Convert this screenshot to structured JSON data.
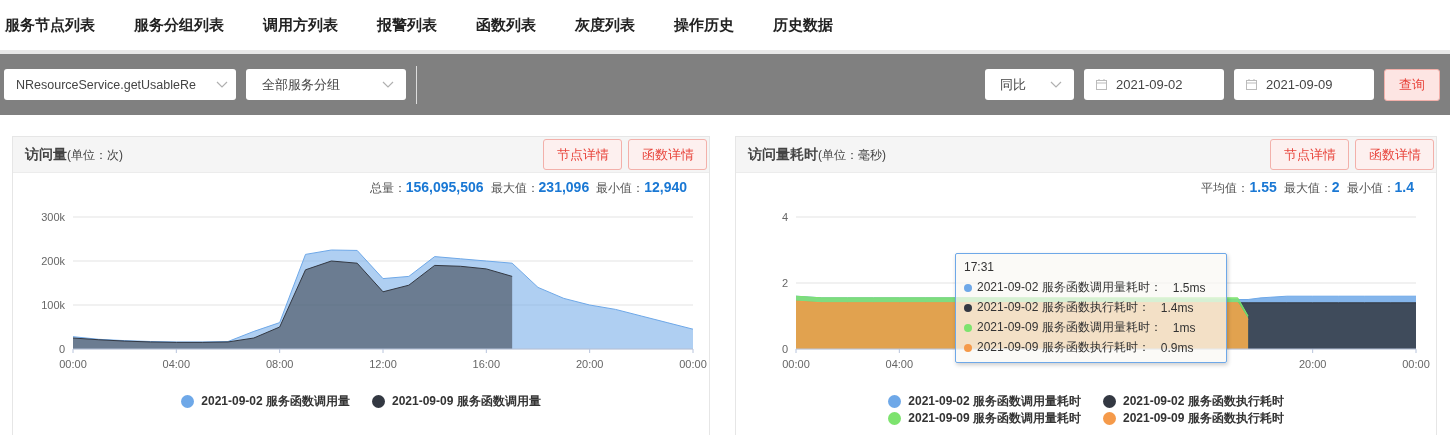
{
  "nav": {
    "tabs": [
      "服务节点列表",
      "服务分组列表",
      "调用方列表",
      "报警列表",
      "函数列表",
      "灰度列表",
      "操作历史",
      "历史数据"
    ]
  },
  "toolbar": {
    "function_select": "NResourceService.getUsableRe",
    "group_select": "全部服务分组",
    "compare_select": "同比",
    "date_start": "2021-09-02",
    "date_end": "2021-09-09",
    "query_button": "查询"
  },
  "panels": [
    {
      "title": "访问量",
      "unit": "(单位：次)",
      "buttons": [
        "节点详情",
        "函数详情"
      ],
      "stats": [
        {
          "label": "总量：",
          "value": "156,095,506"
        },
        {
          "label": "最大值：",
          "value": "231,096"
        },
        {
          "label": "最小值：",
          "value": "12,940"
        }
      ],
      "chart_data": {
        "type": "area",
        "x": [
          0,
          1,
          2,
          3,
          4,
          5,
          6,
          7,
          8,
          9,
          10,
          11,
          12,
          13,
          14,
          15,
          16,
          17,
          18,
          19,
          20,
          21,
          22,
          23,
          24
        ],
        "xlim": [
          0,
          24
        ],
        "ylim": [
          0,
          300000
        ],
        "yticks": [
          {
            "value": 0,
            "label": "0"
          },
          {
            "value": 100000,
            "label": "100k"
          },
          {
            "value": 200000,
            "label": "200k"
          },
          {
            "value": 300000,
            "label": "300k"
          }
        ],
        "xticks": [
          {
            "value": 0,
            "label": "00:00"
          },
          {
            "value": 4,
            "label": "04:00"
          },
          {
            "value": 8,
            "label": "08:00"
          },
          {
            "value": 12,
            "label": "12:00"
          },
          {
            "value": 16,
            "label": "16:00"
          },
          {
            "value": 20,
            "label": "20:00"
          },
          {
            "value": 24,
            "label": "00:00"
          }
        ],
        "legend": "bottom",
        "series": [
          {
            "name": "2021-09-02 服务函数调用量",
            "color": "#6ea8e8",
            "values": [
              28000,
              22000,
              19000,
              17000,
              16000,
              16000,
              17000,
              40000,
              60000,
              215000,
              225000,
              224000,
              160000,
              165000,
              210000,
              205000,
              200000,
              195000,
              140000,
              115000,
              100000,
              90000,
              75000,
              60000,
              45000
            ]
          },
          {
            "name": "2021-09-09 服务函数调用量",
            "color": "#333842",
            "values": [
              25000,
              21000,
              18000,
              16000,
              15000,
              15000,
              16000,
              25000,
              50000,
              180000,
              200000,
              195000,
              130000,
              145000,
              190000,
              188000,
              182000,
              165000,
              null,
              null,
              null,
              null,
              null,
              null,
              null
            ]
          }
        ]
      }
    },
    {
      "title": "访问量耗时",
      "unit": "(单位：毫秒)",
      "buttons": [
        "节点详情",
        "函数详情"
      ],
      "stats": [
        {
          "label": "平均值：",
          "value": "1.55"
        },
        {
          "label": "最大值：",
          "value": "2"
        },
        {
          "label": "最小值：",
          "value": "1.4"
        }
      ],
      "chart_data": {
        "type": "area",
        "x": [
          0,
          1,
          2,
          3,
          4,
          5,
          6,
          6.4,
          17.1,
          17.5,
          18,
          19,
          20,
          21,
          22,
          23,
          24
        ],
        "xlim": [
          0,
          24
        ],
        "ylim": [
          0,
          4
        ],
        "yticks": [
          0,
          2,
          4
        ],
        "xticks": [
          {
            "value": 0,
            "label": "00:00"
          },
          {
            "value": 4,
            "label": "04:00"
          },
          {
            "value": 20,
            "label": "20:00"
          },
          {
            "value": 24,
            "label": "00:00"
          }
        ],
        "legend": "bottom",
        "series": [
          {
            "name": "2021-09-02 服务函数调用量耗时",
            "color": "#6ea8e8",
            "values": [
              1.6,
              1.55,
              1.55,
              1.55,
              1.55,
              1.55,
              1.55,
              1.55,
              1.5,
              1.5,
              1.55,
              1.6,
              1.6,
              1.6,
              1.6,
              1.6,
              1.6
            ]
          },
          {
            "name": "2021-09-02 服务函数执行耗时",
            "color": "#333842",
            "values": [
              1.45,
              1.4,
              1.4,
              1.4,
              1.4,
              1.4,
              1.4,
              1.4,
              1.4,
              1.4,
              1.4,
              1.4,
              1.4,
              1.4,
              1.4,
              1.4,
              1.4
            ]
          },
          {
            "name": "2021-09-09 服务函数调用量耗时",
            "color": "#7de36e",
            "values": [
              1.6,
              1.55,
              1.55,
              1.55,
              1.55,
              1.55,
              1.55,
              1.55,
              1.55,
              1.0,
              null,
              null,
              null,
              null,
              null,
              null,
              null
            ]
          },
          {
            "name": "2021-09-09 服务函数执行耗时",
            "color": "#f59a4a",
            "values": [
              1.45,
              1.4,
              1.4,
              1.4,
              1.4,
              1.4,
              1.4,
              1.4,
              1.4,
              0.9,
              null,
              null,
              null,
              null,
              null,
              null,
              null
            ]
          }
        ]
      },
      "tooltip": {
        "time": "17:31",
        "rows": [
          {
            "label": "2021-09-02 服务函数调用量耗时：",
            "value": "1.5ms",
            "color": "#6ea8e8"
          },
          {
            "label": "2021-09-02 服务函数执行耗时：",
            "value": "1.4ms",
            "color": "#333842"
          },
          {
            "label": "2021-09-09 服务函数调用量耗时：",
            "value": "1ms",
            "color": "#7de36e"
          },
          {
            "label": "2021-09-09 服务函数执行耗时：",
            "value": "0.9ms",
            "color": "#f59a4a"
          }
        ]
      }
    }
  ]
}
